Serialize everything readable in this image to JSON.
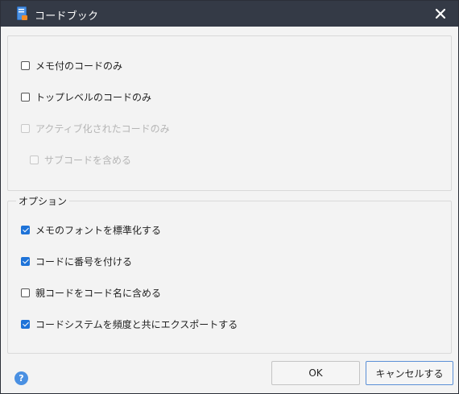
{
  "window": {
    "title": "コードブック",
    "title_icon": "codebook-icon",
    "close_icon": "close-icon"
  },
  "top_group": {
    "options": [
      {
        "label": "メモ付のコードのみ",
        "checked": false,
        "disabled": false
      },
      {
        "label": "トップレベルのコードのみ",
        "checked": false,
        "disabled": false
      },
      {
        "label": "アクティブ化されたコードのみ",
        "checked": false,
        "disabled": true
      },
      {
        "label": "サブコードを含める",
        "checked": false,
        "disabled": true
      }
    ]
  },
  "options_group": {
    "legend": "オプション",
    "options": [
      {
        "label": "メモのフォントを標準化する",
        "checked": true
      },
      {
        "label": "コードに番号を付ける",
        "checked": true
      },
      {
        "label": "親コードをコード名に含める",
        "checked": false
      },
      {
        "label": "コードシステムを頻度と共にエクスポートする",
        "checked": true
      }
    ]
  },
  "footer": {
    "help_icon": "help-icon",
    "help_glyph": "?",
    "ok_label": "OK",
    "cancel_label": "キャンセルする"
  },
  "colors": {
    "titlebar": "#343a46",
    "accent": "#1e73d8",
    "help": "#4a90e2"
  }
}
